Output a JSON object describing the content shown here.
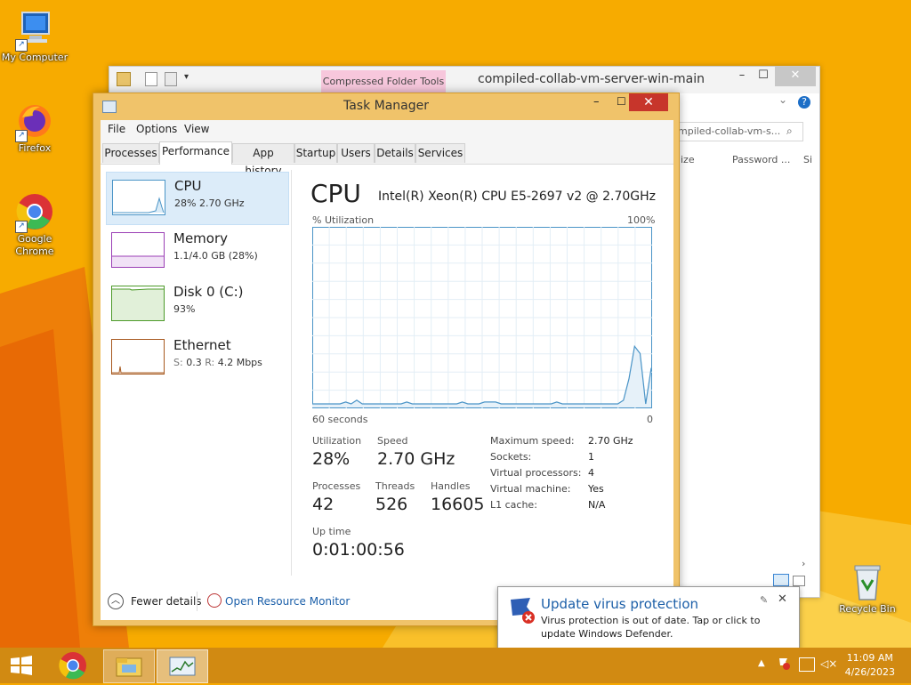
{
  "desktop": {
    "icons": [
      {
        "label": "My Computer"
      },
      {
        "label": "Firefox"
      },
      {
        "label": "Google Chrome"
      },
      {
        "label": "Recycle Bin"
      }
    ]
  },
  "explorer": {
    "title": "compiled-collab-vm-server-win-main",
    "ribbon_tab": "Compressed Folder Tools",
    "search_placeholder": "mpiled-collab-vm-s...",
    "columns": [
      "ize",
      "Password ...",
      "Si"
    ]
  },
  "task_manager": {
    "title": "Task Manager",
    "menu": [
      "File",
      "Options",
      "View"
    ],
    "tabs": [
      "Processes",
      "Performance",
      "App history",
      "Startup",
      "Users",
      "Details",
      "Services"
    ],
    "active_tab": "Performance",
    "resources": [
      {
        "name": "CPU",
        "detail": "28% 2.70 GHz",
        "color": "#4a94c7"
      },
      {
        "name": "Memory",
        "detail": "1.1/4.0 GB (28%)",
        "color": "#9b3fb5"
      },
      {
        "name": "Disk 0 (C:)",
        "detail": "93%",
        "color": "#4d9a2a"
      },
      {
        "name": "Ethernet",
        "detail_prefix_s": "S:",
        "detail_s": "0.3",
        "detail_prefix_r": "R:",
        "detail_r": "4.2 Mbps",
        "color": "#a7581e"
      }
    ],
    "cpu": {
      "heading": "CPU",
      "model": "Intel(R) Xeon(R) CPU E5-2697 v2 @ 2.70GHz",
      "util_label": "% Utilization",
      "max_label": "100%",
      "time_label": "60 seconds",
      "zero_label": "0",
      "graph_values": [
        2,
        2,
        2,
        2,
        2,
        2,
        3,
        2,
        4,
        2,
        2,
        2,
        2,
        2,
        2,
        2,
        2,
        3,
        2,
        2,
        2,
        2,
        2,
        2,
        2,
        2,
        2,
        3,
        2,
        2,
        2,
        3,
        3,
        3,
        2,
        2,
        2,
        2,
        2,
        2,
        2,
        2,
        2,
        2,
        3,
        2,
        2,
        2,
        2,
        2,
        2,
        2,
        2,
        2,
        2,
        2,
        4,
        16,
        34,
        30,
        2,
        22
      ],
      "stats": {
        "utilization_label": "Utilization",
        "utilization": "28%",
        "speed_label": "Speed",
        "speed": "2.70 GHz",
        "processes_label": "Processes",
        "processes": "42",
        "threads_label": "Threads",
        "threads": "526",
        "handles_label": "Handles",
        "handles": "16605",
        "uptime_label": "Up time",
        "uptime": "0:01:00:56"
      },
      "details": [
        {
          "key": "Maximum speed:",
          "value": "2.70 GHz"
        },
        {
          "key": "Sockets:",
          "value": "1"
        },
        {
          "key": "Virtual processors:",
          "value": "4"
        },
        {
          "key": "Virtual machine:",
          "value": "Yes"
        },
        {
          "key": "L1 cache:",
          "value": "N/A"
        }
      ]
    },
    "footer": {
      "fewer_details": "Fewer details",
      "resource_monitor": "Open Resource Monitor"
    }
  },
  "notification": {
    "title": "Update virus protection",
    "message": "Virus protection is out of date. Tap or click to update Windows Defender."
  },
  "taskbar": {
    "time": "11:09 AM",
    "date": "4/26/2023"
  },
  "colors": {
    "desktop": "#f6a800",
    "taskbar": "#d18a12",
    "accent_blue": "#1c5fa8"
  }
}
